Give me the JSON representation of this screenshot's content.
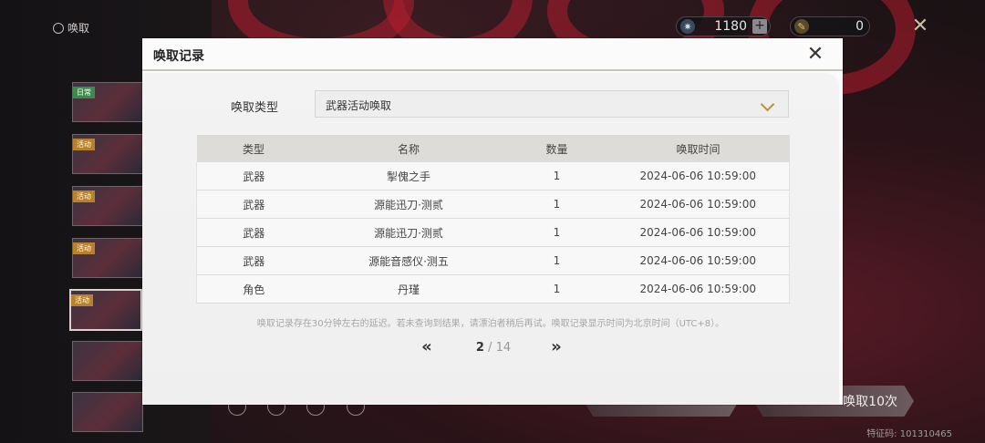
{
  "app": {
    "nav_label": "唤取",
    "currencies": [
      {
        "icon": "astrite-icon",
        "value": "1180"
      },
      {
        "icon": "feather-icon",
        "value": "0"
      }
    ],
    "banners": [
      {
        "tag": "日常"
      },
      {
        "tag": "活动"
      },
      {
        "tag": "活动"
      },
      {
        "tag": "活动"
      },
      {
        "tag": "活动"
      },
      {
        "tag": ""
      },
      {
        "tag": ""
      }
    ],
    "bottom_buttons": [
      "唤取10次"
    ],
    "uid": "特征码: 101310465"
  },
  "modal": {
    "title": "唤取记录",
    "type_label": "唤取类型",
    "selected_type": "武器活动唤取",
    "columns": [
      "类型",
      "名称",
      "数量",
      "唤取时间"
    ],
    "rows": [
      {
        "type": "武器",
        "name": "掣傀之手",
        "qty": "1",
        "time": "2024-06-06 10:59:00",
        "rarity": "gold"
      },
      {
        "type": "武器",
        "name": "源能迅刀·测贰",
        "qty": "1",
        "time": "2024-06-06 10:59:00",
        "rarity": "normal"
      },
      {
        "type": "武器",
        "name": "源能迅刀·测贰",
        "qty": "1",
        "time": "2024-06-06 10:59:00",
        "rarity": "normal"
      },
      {
        "type": "武器",
        "name": "源能音感仪·测五",
        "qty": "1",
        "time": "2024-06-06 10:59:00",
        "rarity": "normal"
      },
      {
        "type": "角色",
        "name": "丹瑾",
        "qty": "1",
        "time": "2024-06-06 10:59:00",
        "rarity": "purple"
      }
    ],
    "note": "唤取记录存在30分钟左右的延迟。若未查询到结果，请漂泊者稍后再试。唤取记录显示时间为北京时间（UTC+8）。",
    "pager": {
      "current": "2",
      "separator": " / ",
      "total": "14"
    }
  },
  "colors": {
    "gold": "#d6a21b",
    "purple": "#9a5bb4",
    "accent": "#b8923a"
  }
}
